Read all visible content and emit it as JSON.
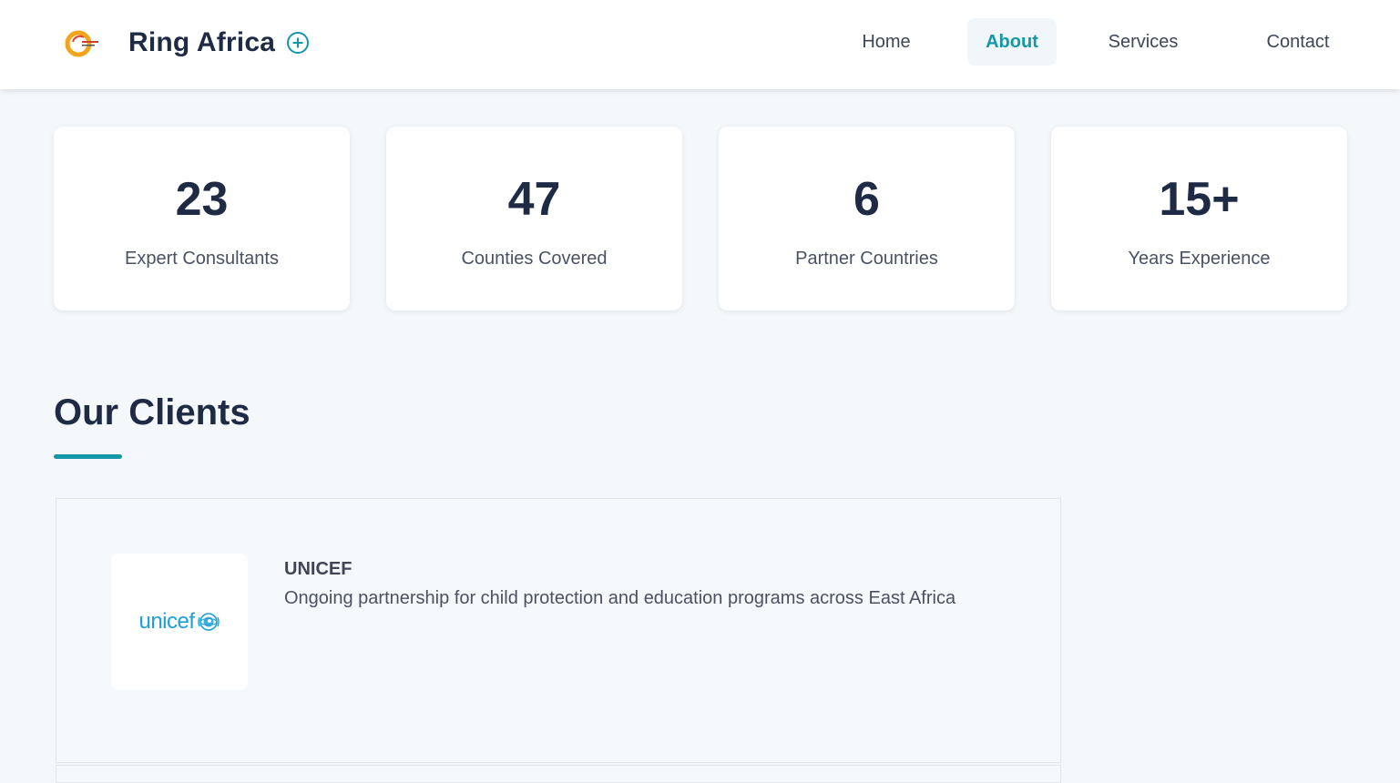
{
  "header": {
    "brand_name": "Ring Africa",
    "nav": [
      {
        "label": "Home",
        "active": false
      },
      {
        "label": "About",
        "active": true
      },
      {
        "label": "Services",
        "active": false
      },
      {
        "label": "Contact",
        "active": false
      }
    ]
  },
  "stats": [
    {
      "value": "23",
      "label": "Expert Consultants"
    },
    {
      "value": "47",
      "label": "Counties Covered"
    },
    {
      "value": "6",
      "label": "Partner Countries"
    },
    {
      "value": "15+",
      "label": "Years Experience"
    }
  ],
  "clients_section": {
    "title": "Our Clients",
    "clients": [
      {
        "logo_text": "unicef",
        "name": "UNICEF",
        "description": "Ongoing partnership for child protection and education programs across East Africa"
      }
    ]
  },
  "colors": {
    "accent": "#1498a8",
    "heading": "#1f2b45",
    "background": "#f5f8fb",
    "unicef_blue": "#1ca0d8"
  },
  "icons": {
    "brand_logo": "ring-africa-logo",
    "brand_plus": "plus-circle-icon",
    "unicef_emblem": "globe-icon"
  }
}
